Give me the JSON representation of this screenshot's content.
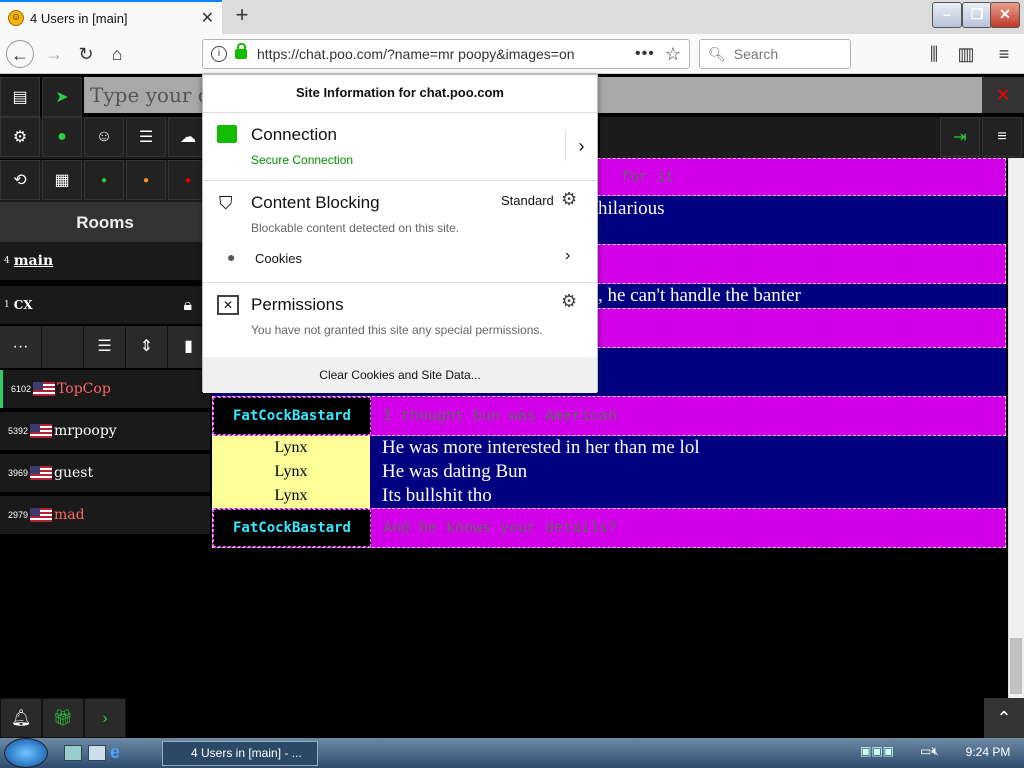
{
  "browser": {
    "tab_title": "4 Users in [main]",
    "url": "https://chat.poo.com/?name=mr poopy&images=on",
    "search_placeholder": "Search"
  },
  "chat": {
    "input_placeholder": "Type your cha",
    "rooms_title": "Rooms",
    "rooms": [
      {
        "count": "4",
        "name": "main"
      },
      {
        "count": "1",
        "name": "CX"
      }
    ],
    "users": [
      {
        "id": "6102",
        "name": "TopCop",
        "color": "#ff6666"
      },
      {
        "id": "5392",
        "name": "mrpoopy",
        "color": "#ffffff"
      },
      {
        "id": "3969",
        "name": "guest",
        "color": "#ffffff"
      },
      {
        "id": "2979",
        "name": "mad",
        "color": "#ff6666"
      }
    ],
    "messages": [
      {
        "user": "",
        "text": "for it"
      },
      {
        "user": "",
        "text": "hilarious"
      },
      {
        "user": "",
        "text": ""
      },
      {
        "user": "",
        "text": ", he can't handle the banter"
      },
      {
        "user": "",
        "text": ""
      },
      {
        "user": "",
        "text": ""
      },
      {
        "user": "FatCockBastard",
        "text": "I thought bun was American"
      },
      {
        "user": "Lynx",
        "text": "He was more interested in her than me lol"
      },
      {
        "user": "Lynx",
        "text": "He was dating Bun"
      },
      {
        "user": "Lynx",
        "text": "Its bullshit tho"
      },
      {
        "user": "FatCockBastard",
        "text": "And he knows your details?"
      }
    ]
  },
  "popup": {
    "header": "Site Information for chat.poo.com",
    "connection_title": "Connection",
    "connection_status": "Secure Connection",
    "content_blocking_title": "Content Blocking",
    "content_blocking_level": "Standard",
    "content_blocking_sub": "Blockable content detected on this site.",
    "cookies_label": "Cookies",
    "permissions_title": "Permissions",
    "permissions_sub": "You have not granted this site any special permissions.",
    "clear_button": "Clear Cookies and Site Data..."
  },
  "taskbar": {
    "task_label": "4 Users in [main] - ...",
    "clock": "9:24 PM"
  }
}
